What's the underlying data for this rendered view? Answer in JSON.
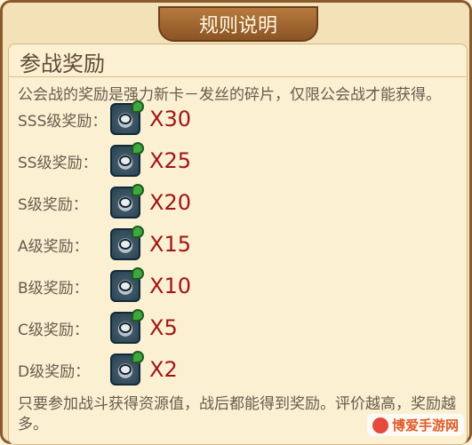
{
  "header": {
    "title": "规则说明"
  },
  "section": {
    "title": "参战奖励",
    "description": "公会战的奖励是强力新卡－发丝的碎片，仅限公会战才能获得。"
  },
  "rewards": [
    {
      "grade": "SSS级奖励：",
      "qty": "X30"
    },
    {
      "grade": "SS级奖励：",
      "qty": "X25"
    },
    {
      "grade": "S级奖励：",
      "qty": "X20"
    },
    {
      "grade": "A级奖励：",
      "qty": "X15"
    },
    {
      "grade": "B级奖励：",
      "qty": "X10"
    },
    {
      "grade": "C级奖励：",
      "qty": "X5"
    },
    {
      "grade": "D级奖励：",
      "qty": "X2"
    }
  ],
  "footer": {
    "text": "只要参加战斗获得资源值，战后都能得到奖励。评价越高，奖励越多。"
  },
  "watermark": {
    "text": "博爱手游网"
  },
  "icons": {
    "reward_icon": "hair-fragment-card-icon",
    "close_icon": "close-icon",
    "logo_icon": "site-logo-icon"
  }
}
